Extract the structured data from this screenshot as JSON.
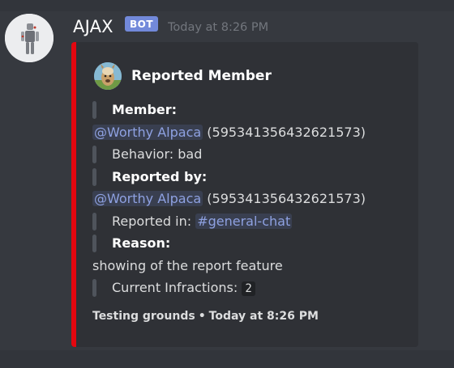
{
  "message": {
    "author": "AJAX",
    "bot_badge": "BOT",
    "timestamp": "Today at 8:26 PM"
  },
  "embed": {
    "accent_color": "#e3070f",
    "author_name": "Reported Member",
    "fields": {
      "member_label": "Member:",
      "member_mention": "@Worthy Alpaca",
      "member_id": "(595341356432621573)",
      "behavior": "Behavior: bad",
      "reported_by_label": "Reported by:",
      "reporter_mention": "@Worthy Alpaca",
      "reporter_id": "(595341356432621573)",
      "reported_in_label": "Reported in:",
      "reported_in_channel": "#general-chat",
      "reason_label": "Reason:",
      "reason_text": "showing of the report feature",
      "infractions_label": "Current Infractions:",
      "infractions_count": "2"
    },
    "footer": {
      "text": "Testing grounds",
      "separator": "•",
      "timestamp": "Today at 8:26 PM"
    }
  },
  "icons": {
    "avatar": "robot-avatar",
    "author_icon": "alpaca-avatar"
  }
}
